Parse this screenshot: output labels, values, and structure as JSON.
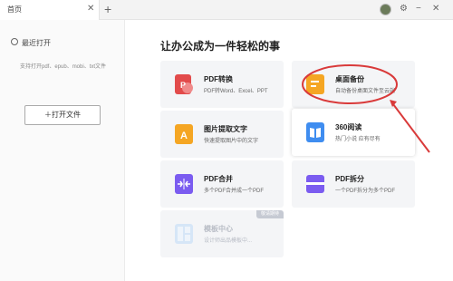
{
  "tab": {
    "label": "首页",
    "close_icon": "close-icon",
    "add_icon": "plus-icon"
  },
  "window": {
    "settings_icon": "gear-icon",
    "minimize": "−",
    "close": "✕"
  },
  "sidebar": {
    "recent_title": "最近打开",
    "support_text": "支持打开pdf、epub、mobi、txt文件",
    "open_file_label": "＋打开文件"
  },
  "main": {
    "title": "让办公成为一件轻松的事",
    "cards": [
      {
        "title": "PDF转换",
        "subtitle": "PDF转Word、Excel、PPT",
        "icon": "pdf-convert-icon"
      },
      {
        "title": "桌面备份",
        "subtitle": "自动备份桌面文件至云端",
        "icon": "desktop-backup-icon"
      },
      {
        "title": "图片提取文字",
        "subtitle": "快速提取图片中的文字",
        "icon": "image-text-icon"
      },
      {
        "title": "360阅读",
        "subtitle": "热门小说 应有尽有",
        "icon": "book-icon"
      },
      {
        "title": "PDF合并",
        "subtitle": "多个PDF合并成一个PDF",
        "icon": "merge-icon"
      },
      {
        "title": "PDF拆分",
        "subtitle": "一个PDF拆分为多个PDF",
        "icon": "split-icon"
      },
      {
        "title": "模板中心",
        "subtitle": "设计师出品模板中...",
        "icon": "template-icon",
        "badge": "敬请期待"
      }
    ]
  },
  "colors": {
    "accent_red": "#d93a3a",
    "orange": "#f5a623",
    "blue": "#3f8df0",
    "purple": "#7b5cf0"
  }
}
